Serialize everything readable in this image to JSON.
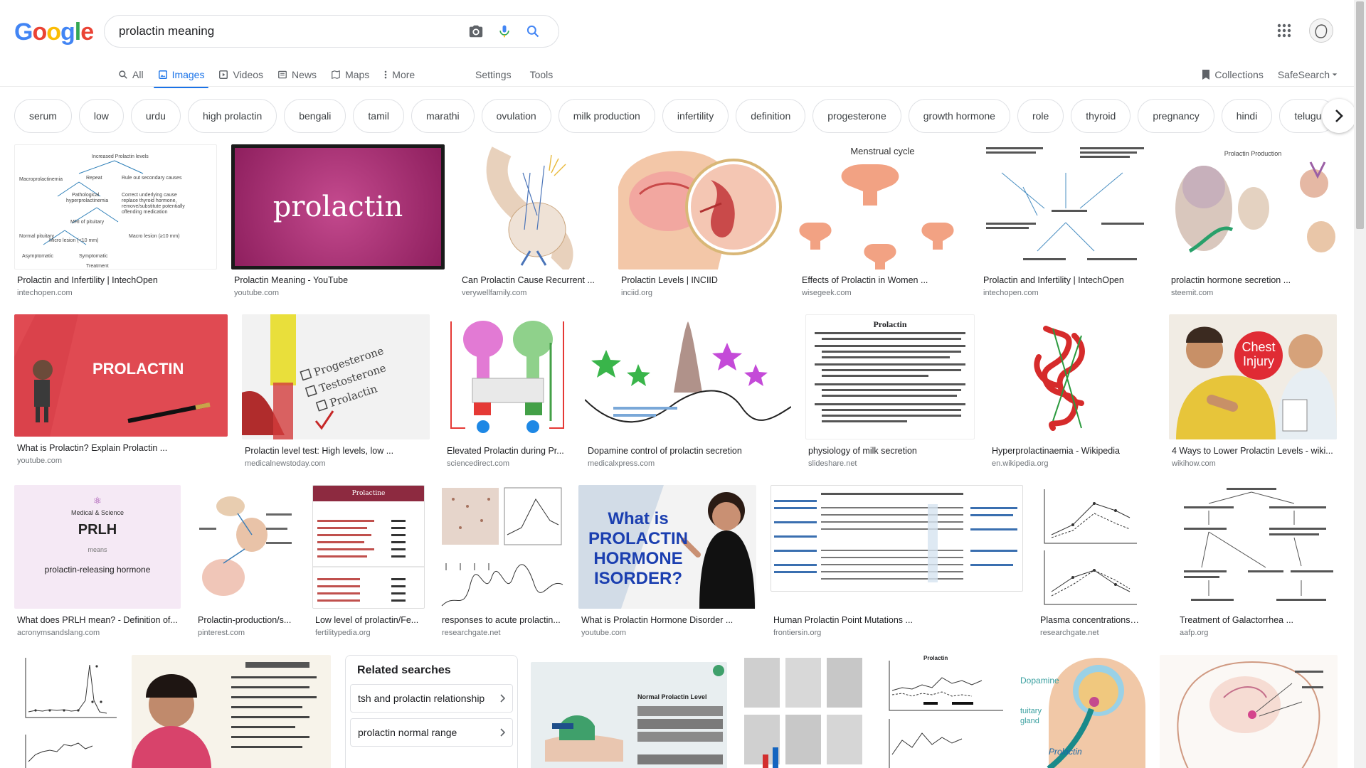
{
  "logo": "Google",
  "search": {
    "query": "prolactin meaning"
  },
  "tabs": [
    {
      "label": "All",
      "icon": "search-icon"
    },
    {
      "label": "Images",
      "icon": "image-icon",
      "active": true
    },
    {
      "label": "Videos",
      "icon": "video-icon"
    },
    {
      "label": "News",
      "icon": "news-icon"
    },
    {
      "label": "Maps",
      "icon": "map-icon"
    },
    {
      "label": "More",
      "icon": "more-dots-icon"
    }
  ],
  "tools": {
    "settings": "Settings",
    "tools": "Tools"
  },
  "right": {
    "collections": "Collections",
    "safesearch": "SafeSearch"
  },
  "chips": [
    "serum",
    "low",
    "urdu",
    "high prolactin",
    "bengali",
    "tamil",
    "marathi",
    "ovulation",
    "milk production",
    "infertility",
    "definition",
    "progesterone",
    "growth hormone",
    "role",
    "thyroid",
    "pregnancy",
    "hindi",
    "telugu"
  ],
  "images": {
    "r1": [
      {
        "title": "Prolactin and Infertility | IntechOpen",
        "source": "intechopen.com"
      },
      {
        "title": "Prolactin Meaning - YouTube",
        "source": "youtube.com",
        "overlay": "prolactin"
      },
      {
        "title": "Can Prolactin Cause Recurrent ...",
        "source": "verywellfamily.com"
      },
      {
        "title": "Prolactin Levels | INCIID",
        "source": "inciid.org"
      },
      {
        "title": "Effects of Prolactin in Women ...",
        "source": "wisegeek.com",
        "overlay": "Menstrual cycle"
      },
      {
        "title": "Prolactin and Infertility | IntechOpen",
        "source": "intechopen.com"
      },
      {
        "title": "prolactin hormone secretion ...",
        "source": "steemit.com",
        "overlay": "Prolactin Production"
      }
    ],
    "r2": [
      {
        "title": "What is Prolactin? Explain Prolactin ...",
        "source": "youtube.com",
        "overlay": "PROLACTIN"
      },
      {
        "title": "Prolactin level test: High levels, low ...",
        "source": "medicalnewstoday.com",
        "overlay": "Progesterone Testosterone Prolactin"
      },
      {
        "title": "Elevated Prolactin during Pr...",
        "source": "sciencedirect.com"
      },
      {
        "title": "Dopamine control of prolactin secretion",
        "source": "medicalxpress.com"
      },
      {
        "title": "physiology of milk secretion",
        "source": "slideshare.net",
        "overlay": "Prolactin"
      },
      {
        "title": "Hyperprolactinaemia - Wikipedia",
        "source": "en.wikipedia.org"
      },
      {
        "title": "4 Ways to Lower Prolactin Levels - wiki...",
        "source": "wikihow.com",
        "overlay": "Chest Injury"
      }
    ],
    "r3": [
      {
        "title": "What does PRLH mean? - Definition of...",
        "source": "acronymsandslang.com",
        "overlay": "PRLH",
        "overlay2": "prolactin-releasing hormone",
        "overlay3": "Medical & Science",
        "overlay4": "means"
      },
      {
        "title": "Prolactin-production/s...",
        "source": "pinterest.com"
      },
      {
        "title": "Low level of prolactin/Fe...",
        "source": "fertilitypedia.org",
        "overlay": "Prolactine"
      },
      {
        "title": "responses to acute prolactin...",
        "source": "researchgate.net"
      },
      {
        "title": "What is Prolactin Hormone Disorder ...",
        "source": "youtube.com",
        "overlay": "What is PROLACTIN HORMONE ISORDER?"
      },
      {
        "title": "Human Prolactin Point Mutations ...",
        "source": "frontiersin.org"
      },
      {
        "title": "Plasma concentrations of pr...",
        "source": "researchgate.net"
      },
      {
        "title": "Treatment of Galactorrhea ...",
        "source": "aafp.org"
      }
    ]
  },
  "related": {
    "heading": "Related searches",
    "items": [
      "tsh and prolactin relationship",
      "prolactin normal range"
    ]
  },
  "r4": {
    "normal_level_label": "Normal Prolactin Level",
    "prolactin_label": "Prolactin"
  },
  "colors": {
    "accent": "#1a73e8",
    "prolactin_purple": "#b5367c",
    "prolactin_red": "#e04a52"
  }
}
